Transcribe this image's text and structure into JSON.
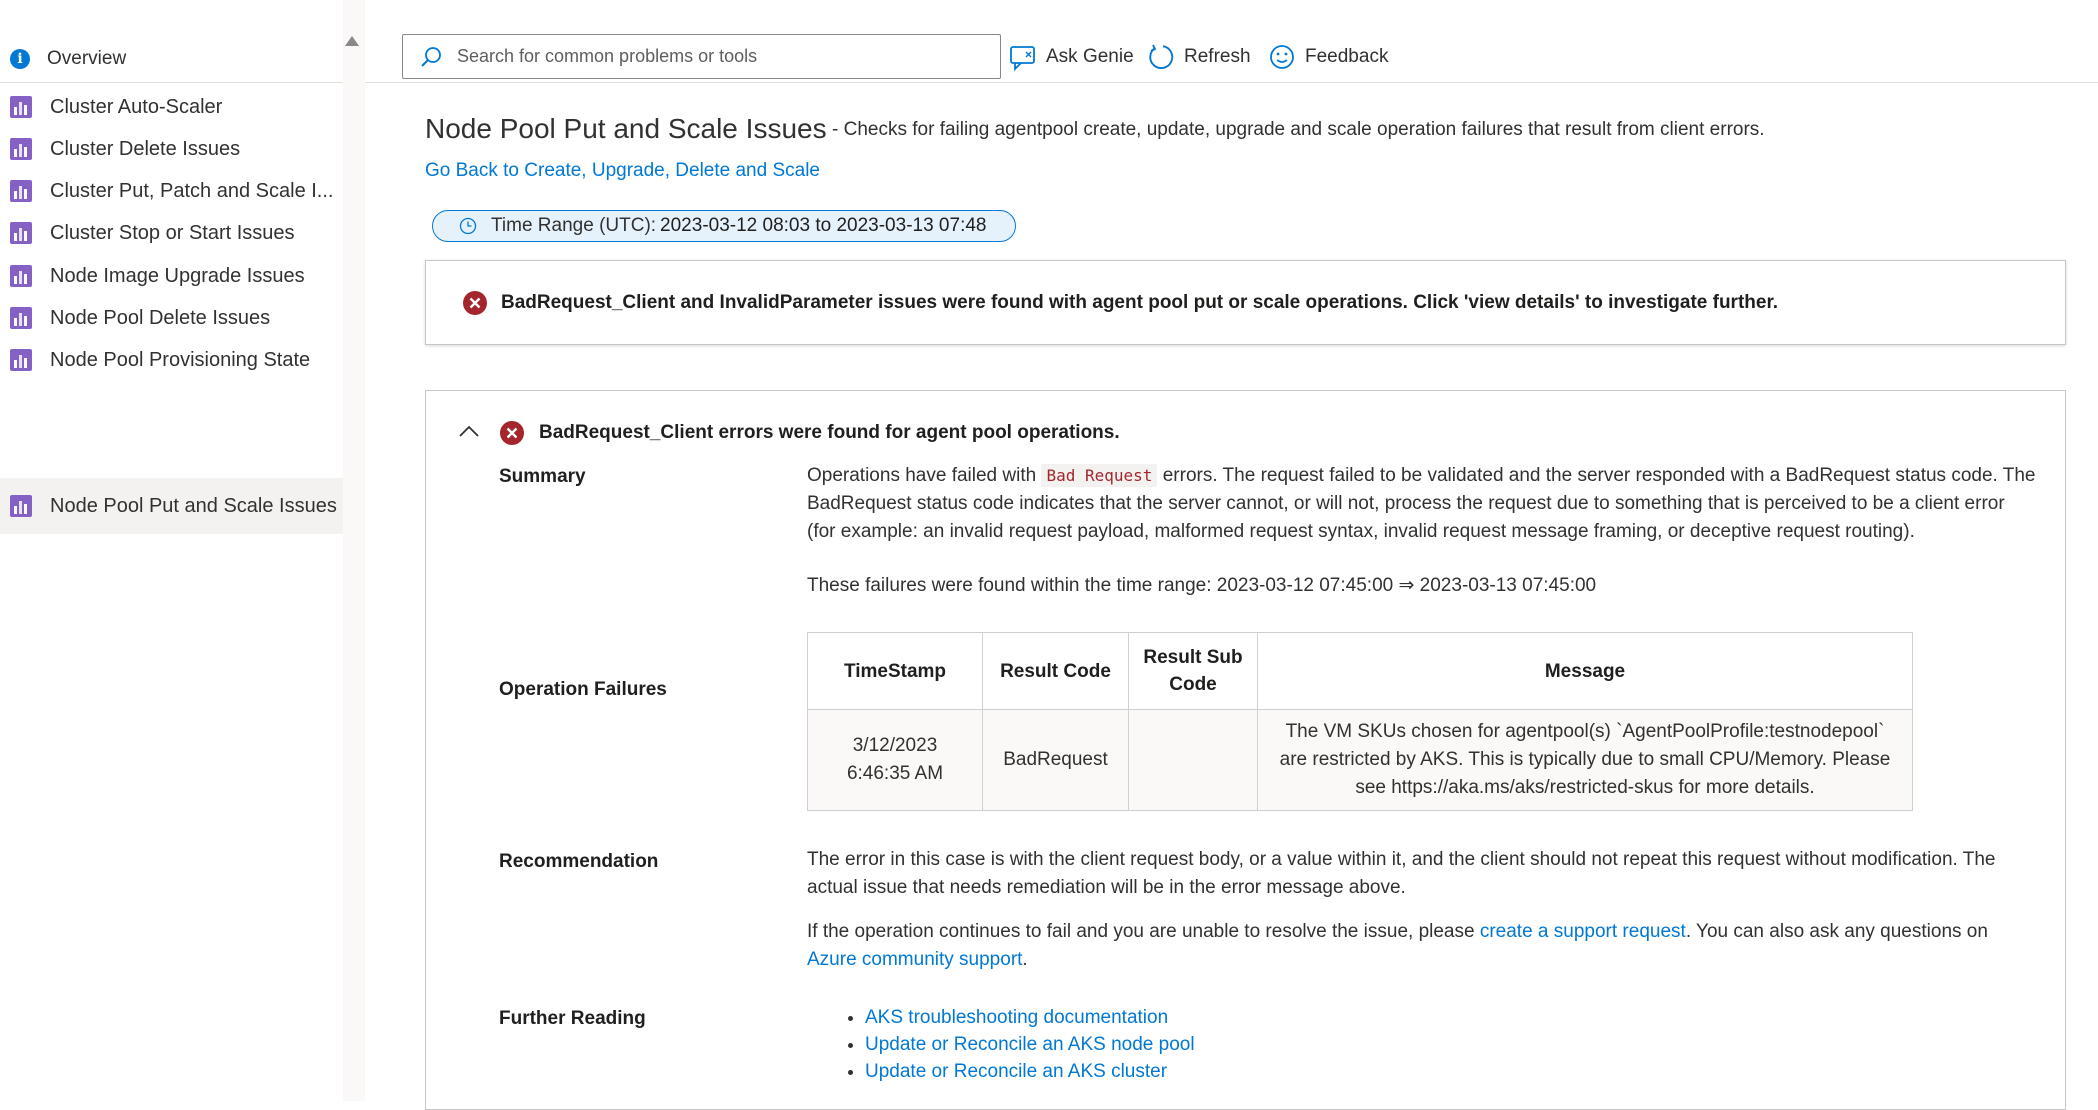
{
  "sidebar": {
    "overview_label": "Overview",
    "items": [
      {
        "label": "Cluster Auto-Scaler"
      },
      {
        "label": "Cluster Delete Issues"
      },
      {
        "label": "Cluster Put, Patch and Scale I..."
      },
      {
        "label": "Cluster Stop or Start Issues"
      },
      {
        "label": "Node Image Upgrade Issues"
      },
      {
        "label": "Node Pool Delete Issues"
      },
      {
        "label": "Node Pool Provisioning State"
      },
      {
        "label": "Node Pool Put and Scale Issues"
      }
    ],
    "active_index": 7
  },
  "toolbar": {
    "search_placeholder": "Search for common problems or tools",
    "ask_genie_label": "Ask Genie",
    "refresh_label": "Refresh",
    "feedback_label": "Feedback"
  },
  "page": {
    "title": "Node Pool Put and Scale Issues",
    "subtitle": "-  Checks for failing agentpool create, update, upgrade and scale operation failures that result from client errors.",
    "back_link": "Go Back to Create, Upgrade, Delete and Scale",
    "time_range_label": "Time Range (UTC):",
    "time_range_value": "2023-03-12 08:03 to 2023-03-13 07:48"
  },
  "alert": {
    "text": "BadRequest_Client and InvalidParameter issues were found with agent pool put or scale operations. Click 'view details' to investigate further."
  },
  "detail": {
    "heading": "BadRequest_Client errors were found for agent pool operations.",
    "summary_label": "Summary",
    "summary_pre": "Operations have failed with",
    "summary_code": "Bad Request",
    "summary_post": "errors. The request failed to be validated and the server responded with a BadRequest status code. The BadRequest status code indicates that the server cannot, or will not, process the request due to something that is perceived to be a client error (for example: an invalid request payload, malformed request syntax, invalid request message framing, or deceptive request routing).",
    "time_range_text": "These failures were found within the time range: 2023-03-12 07:45:00 ⇒ 2023-03-13 07:45:00",
    "operation_failures_label": "Operation Failures",
    "table": {
      "headers": [
        "TimeStamp",
        "Result Code",
        "Result Sub Code",
        "Message"
      ],
      "rows": [
        {
          "timestamp_date": "3/12/2023",
          "timestamp_time": "6:46:35 AM",
          "result_code": "BadRequest",
          "result_sub_code": "",
          "message": "The VM SKUs chosen for agentpool(s) `AgentPoolProfile:testnodepool` are restricted by AKS. This is typically due to small CPU/Memory. Please see https://aka.ms/aks/restricted-skus for more details."
        }
      ]
    },
    "recommendation_label": "Recommendation",
    "recommendation_text": "The error in this case is with the client request body, or a value within it, and the client should not repeat this request without modification. The actual issue that needs remediation will be in the error message above.",
    "support_pre": "If the operation continues to fail and you are unable to resolve the issue, please",
    "support_link": "create a support request",
    "support_mid": ". You can also ask any questions on",
    "community_link": "Azure community support",
    "support_end": ".",
    "further_reading_label": "Further Reading",
    "further_reading": [
      "AKS troubleshooting documentation",
      "Update or Reconcile an AKS node pool",
      "Update or Reconcile an AKS cluster"
    ]
  },
  "colors": {
    "accent": "#0078d4",
    "error": "#a4262c",
    "nav_icon": "#8661c5"
  }
}
